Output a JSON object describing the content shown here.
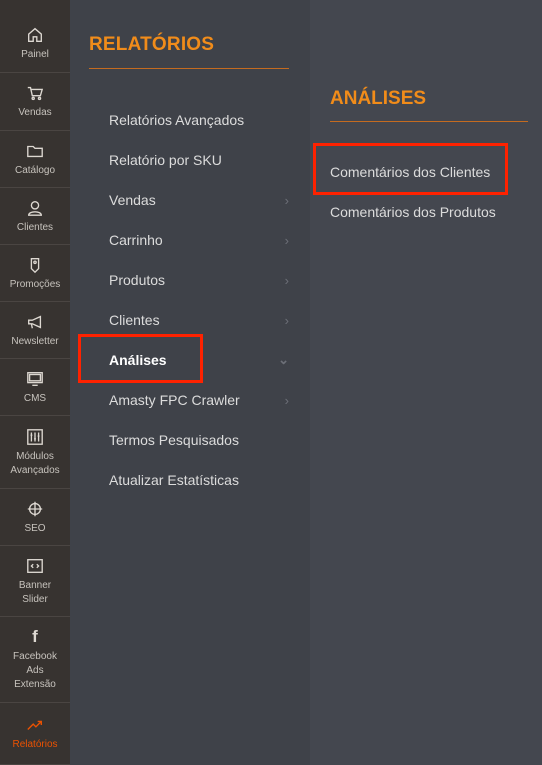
{
  "rail": {
    "items": [
      {
        "label": "Painel",
        "icon": "home-icon"
      },
      {
        "label": "Vendas",
        "icon": "cart-icon"
      },
      {
        "label": "Catálogo",
        "icon": "folder-icon"
      },
      {
        "label": "Clientes",
        "icon": "user-icon"
      },
      {
        "label": "Promoções",
        "icon": "tag-icon"
      },
      {
        "label": "Newsletter",
        "icon": "megaphone-icon"
      },
      {
        "label": "CMS",
        "icon": "monitor-icon"
      },
      {
        "label": "Módulos\nAvançados",
        "icon": "sliders-icon"
      },
      {
        "label": "SEO",
        "icon": "target-icon"
      },
      {
        "label": "Banner\nSlider",
        "icon": "code-icon"
      },
      {
        "label": "Facebook\nAds\nExtensão",
        "icon": "facebook-icon",
        "glyph": "f"
      },
      {
        "label": "Relatórios",
        "icon": "trend-icon"
      }
    ]
  },
  "panel1": {
    "title": "RELATÓRIOS",
    "items": [
      {
        "label": "Relatórios Avançados"
      },
      {
        "label": "Relatório por SKU"
      },
      {
        "label": "Vendas",
        "chevron": "›"
      },
      {
        "label": "Carrinho",
        "chevron": "›"
      },
      {
        "label": "Produtos",
        "chevron": "›"
      },
      {
        "label": "Clientes",
        "chevron": "›"
      },
      {
        "label": "Análises",
        "chevron": "⌄"
      },
      {
        "label": "Amasty FPC Crawler",
        "chevron": "›"
      },
      {
        "label": "Termos Pesquisados"
      },
      {
        "label": "Atualizar Estatísticas"
      }
    ]
  },
  "panel2": {
    "title": "ANÁLISES",
    "items": [
      {
        "label": "Comentários dos Clientes"
      },
      {
        "label": "Comentários dos Produtos"
      }
    ]
  },
  "colors": {
    "accent": "#f18c1a",
    "highlight": "#ff2200",
    "active_rail": "#eb5202"
  }
}
